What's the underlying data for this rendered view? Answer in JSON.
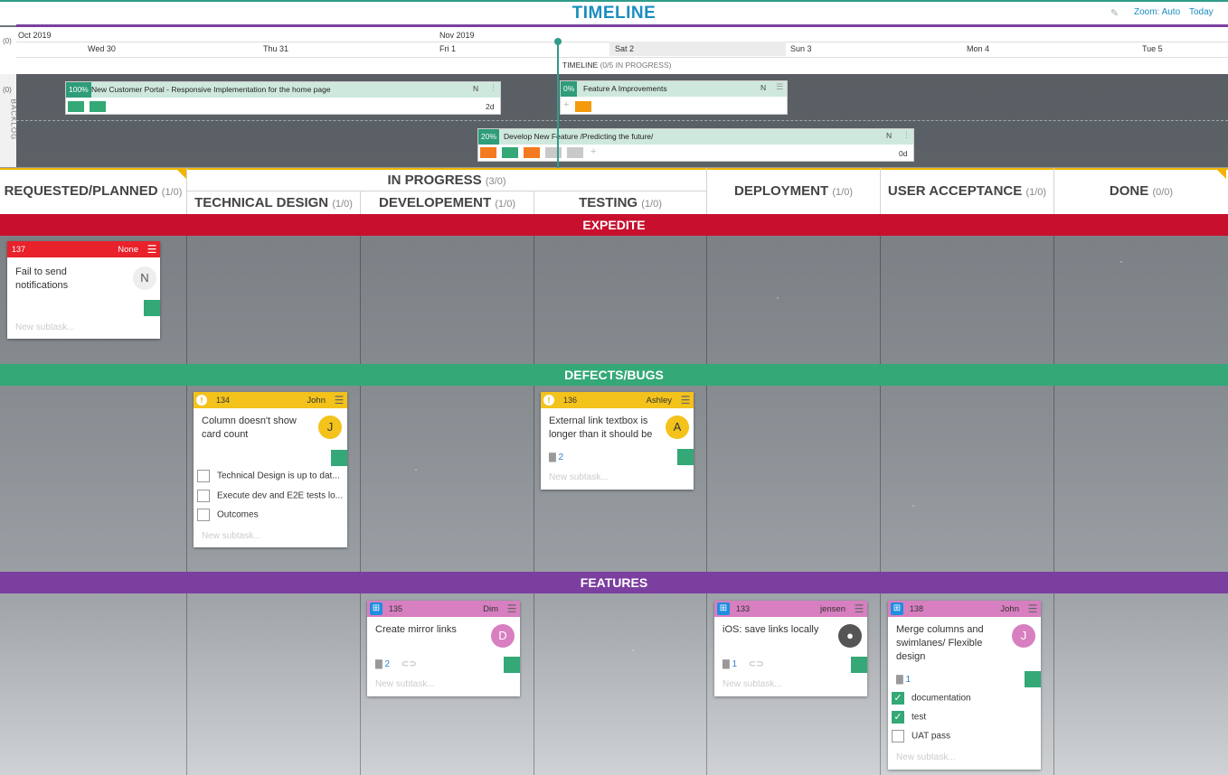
{
  "timeline": {
    "title": "TIMELINE",
    "zoom": "Zoom: Auto",
    "today": "Today",
    "count": "(0)",
    "months": [
      "Oct 2019",
      "Nov 2019"
    ],
    "days": [
      "Wed 30",
      "Thu 31",
      "Fri 1",
      "Sat 2",
      "Sun 3",
      "Mon 4",
      "Tue 5"
    ],
    "summary": "TIMELINE",
    "summary_detail": "(0/5 IN PROGRESS)",
    "backlog_count": "(0)",
    "backlog_label": "BACKLOG",
    "bars": [
      {
        "pct": "100%",
        "title": "New Customer Portal - Responsive Implementation for the home page",
        "owner": "N",
        "duration": "2d"
      },
      {
        "pct": "0%",
        "title": "Feature A Improvements",
        "owner": "N",
        "duration": ""
      },
      {
        "pct": "20%",
        "title": "Develop New Feature /Predicting the future/",
        "owner": "N",
        "duration": "0d"
      }
    ]
  },
  "columns": {
    "requested": {
      "label": "REQUESTED/PLANNED",
      "count": "(1/0)"
    },
    "in_progress": {
      "label": "IN PROGRESS",
      "count": "(3/0)"
    },
    "technical_design": {
      "label": "TECHNICAL DESIGN",
      "count": "(1/0)"
    },
    "development": {
      "label": "DEVELOPEMENT",
      "count": "(1/0)"
    },
    "testing": {
      "label": "TESTING",
      "count": "(1/0)"
    },
    "deployment": {
      "label": "DEPLOYMENT",
      "count": "(1/0)"
    },
    "user_acceptance": {
      "label": "USER ACCEPTANCE",
      "count": "(1/0)"
    },
    "done": {
      "label": "DONE",
      "count": "(0/0)"
    }
  },
  "lanes": {
    "expedite": {
      "label": "EXPEDITE",
      "color": "#c8102e"
    },
    "defects": {
      "label": "DEFECTS/BUGS",
      "color": "#34a877"
    },
    "features": {
      "label": "FEATURES",
      "color": "#7b3fa0"
    }
  },
  "cards": {
    "c137": {
      "id": "137",
      "owner": "None",
      "title_l1": "Fail to send",
      "title_l2": "notifications",
      "avatar": "N",
      "subtask": "New subtask..."
    },
    "c134": {
      "id": "134",
      "owner": "John",
      "title_l1": "Column doesn't show",
      "title_l2": "card count",
      "avatar": "J",
      "todos": [
        "Technical Design is up to dat...",
        "Execute dev and E2E tests lo...",
        "Outcomes"
      ],
      "subtask": "New subtask..."
    },
    "c136": {
      "id": "136",
      "owner": "Ashley",
      "title_l1": "External link textbox is",
      "title_l2": "longer than it should be",
      "avatar": "A",
      "comments": "2",
      "subtask": "New subtask..."
    },
    "c135": {
      "id": "135",
      "owner": "Dim",
      "title_l1": "Create mirror links",
      "avatar": "D",
      "comments": "2",
      "subtask": "New subtask..."
    },
    "c133": {
      "id": "133",
      "owner": "jensen",
      "title_l1": "iOS: save links locally",
      "comments": "1",
      "subtask": "New subtask..."
    },
    "c138": {
      "id": "138",
      "owner": "John",
      "title_l1": "Merge columns and",
      "title_l2": "swimlanes/ Flexible",
      "title_l3": "design",
      "avatar": "J",
      "comments": "1",
      "todos": [
        "documentation",
        "test",
        "UAT pass"
      ],
      "subtask": "New subtask..."
    }
  },
  "colors": {
    "red_head": "#e8212b",
    "yellow_head": "#f3c21b",
    "pink_head": "#d77fc0",
    "green": "#34a877",
    "orange": "#f47a20"
  }
}
